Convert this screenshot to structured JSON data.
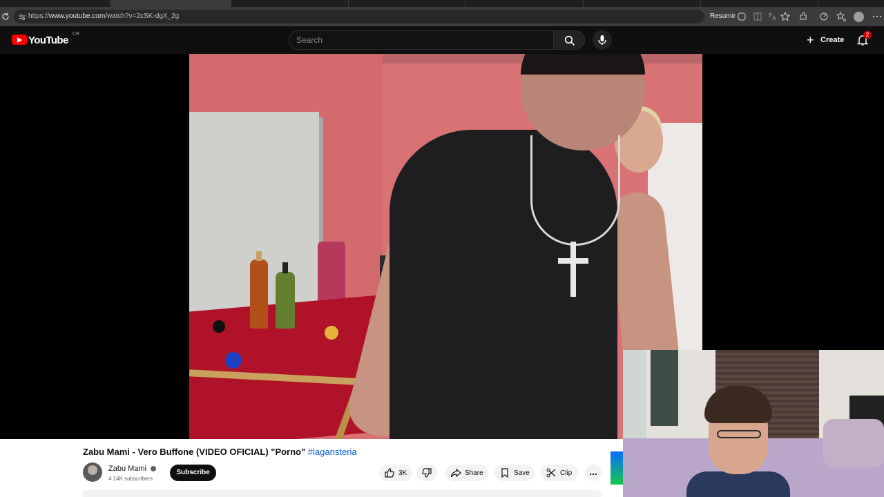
{
  "browser": {
    "url_prefix": "https://",
    "url_domain": "www.youtube.com",
    "url_path": "/watch?v=2cSK-dgX_2g",
    "summarize_label": "Resumir",
    "colors": {
      "chrome_bg": "#3c3c3c",
      "omnibox_bg": "#282828"
    }
  },
  "header": {
    "logo_text": "YouTube",
    "country_code": "CR",
    "search_placeholder": "Search",
    "create_label": "Create",
    "notification_count": "2",
    "colors": {
      "header_bg": "#0f0f0f",
      "brand_red": "#ff0000"
    }
  },
  "video": {
    "title_text": "Zabu Mami - Vero Buffone (VIDEO OFICIAL) \"Porno\"",
    "hashtag": "#lagansteria",
    "channel_name": "Zabu Mami",
    "subscribers": "4.14K subscribers",
    "subscribe_label": "Subscribe",
    "actions": {
      "like_count": "3K",
      "share_label": "Share",
      "save_label": "Save",
      "clip_label": "Clip",
      "more_label": "..."
    },
    "colors": {
      "hashtag": "#065fd4",
      "subscribe_bg": "#0f0f0f"
    }
  }
}
